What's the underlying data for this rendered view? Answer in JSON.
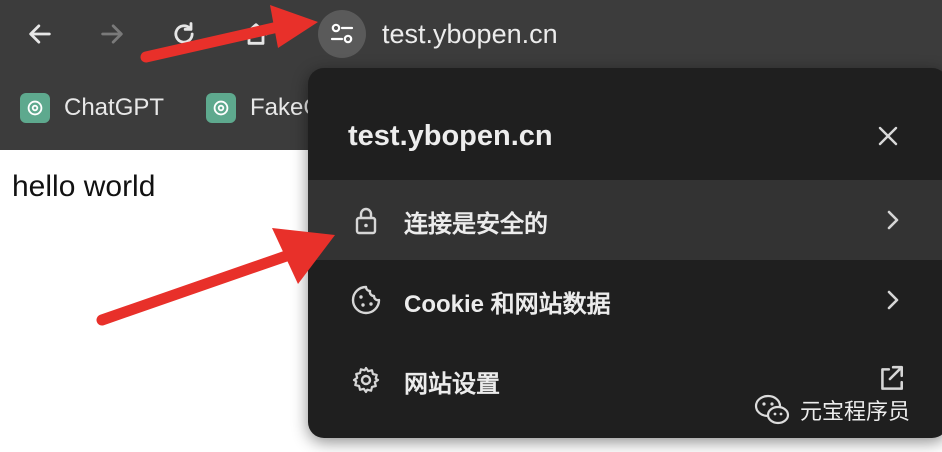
{
  "browser": {
    "address_url": "test.ybopen.cn",
    "bookmarks": [
      {
        "label": "ChatGPT",
        "icon": "openai-icon"
      },
      {
        "label": "FakeG",
        "icon": "openai-icon"
      }
    ]
  },
  "page": {
    "body_text": "hello world"
  },
  "site_popup": {
    "title": "test.ybopen.cn",
    "items": [
      {
        "label": "连接是安全的",
        "icon": "lock-icon",
        "trailing": "chevron-right-icon"
      },
      {
        "label": "Cookie 和网站数据",
        "icon": "cookie-icon",
        "trailing": "chevron-right-icon"
      },
      {
        "label": "网站设置",
        "icon": "gear-icon",
        "trailing": "external-link-icon"
      }
    ]
  },
  "watermark": {
    "text": "元宝程序员",
    "icon": "wechat-icon"
  },
  "colors": {
    "toolbar_bg": "#3c3c3c",
    "popup_bg": "#1f1f1f",
    "highlight_row": "#333333",
    "annotation_arrow": "#e8302a"
  }
}
